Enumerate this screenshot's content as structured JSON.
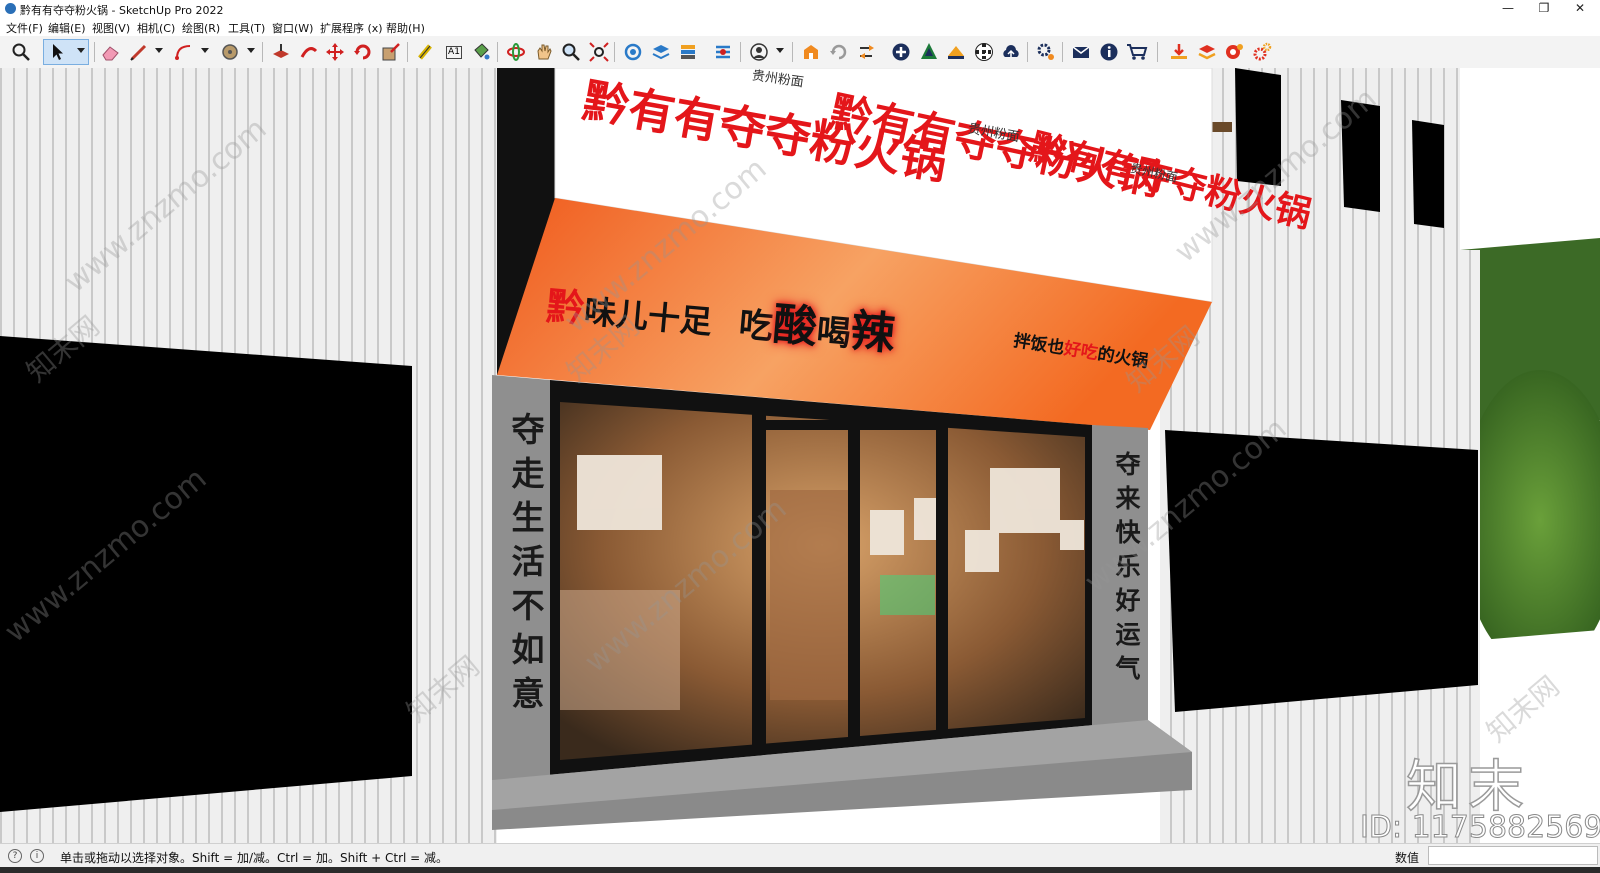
{
  "window": {
    "title": "黔有有夺夺粉火锅 - SketchUp Pro 2022",
    "controls": [
      "—",
      "❐",
      "✕"
    ]
  },
  "menu": [
    "文件(F)",
    "编辑(E)",
    "视图(V)",
    "相机(C)",
    "绘图(R)",
    "工具(T)",
    "窗口(W)",
    "扩展程序 (x)",
    "帮助(H)"
  ],
  "toolbar": {
    "icons": [
      "search-icon",
      "select-arrow-icon",
      "eraser-icon",
      "pencil-icon",
      "arc-icon",
      "circle-icon",
      "push-pull-icon",
      "follow-me-icon",
      "move-icon",
      "rotate-icon",
      "scale-icon",
      "tape-measure-icon",
      "text-label-icon",
      "paint-bucket-icon",
      "orbit-icon",
      "pan-icon",
      "zoom-icon",
      "zoom-extents-icon",
      "section-plane-icon",
      "layers-icon",
      "styles-icon",
      "scenes-icon",
      "user-account-icon",
      "warehouse-icon",
      "refresh-icon",
      "export-icon",
      "add-icon",
      "terrain-icon",
      "solid-tools-icon",
      "checker-icon",
      "cloud-icon",
      "settings-icon",
      "mail-icon",
      "info-icon",
      "cart-icon",
      "import-icon",
      "extension-icon",
      "ruby-icon",
      "gears-icon"
    ],
    "text_label_glyph": "A1"
  },
  "scene": {
    "top_sign_text": "黔有有夺夺粉火锅",
    "top_sign_small": "贵州粉面",
    "orange_sign": {
      "first_char": "黔",
      "phrase_1": "味儿十足",
      "phrase_2_a": "吃",
      "phrase_2_b": "酸",
      "phrase_2_c": "喝",
      "phrase_2_d": "辣",
      "tagline_a": "拌饭也",
      "tagline_b": "好吃",
      "tagline_c": "的火锅"
    },
    "left_couplet": "夺走生活不如意",
    "right_couplet": "夺来快乐好运气",
    "watermark": "www.znzmo.com",
    "watermark_brand": "知末网"
  },
  "status": {
    "message": "单击或拖动以选择对象。Shift = 加/减。Ctrl = 加。Shift + Ctrl = 减。",
    "value_label": "数值",
    "value": ""
  },
  "brand": {
    "logo": "知末",
    "id": "ID: 1175882569"
  },
  "colors": {
    "sign_red": "#e4161a",
    "sign_orange": "#f05a1c",
    "sign_orange_light": "#f7a263",
    "wall": "#ebebeb",
    "selection": "#cfe3f7"
  }
}
